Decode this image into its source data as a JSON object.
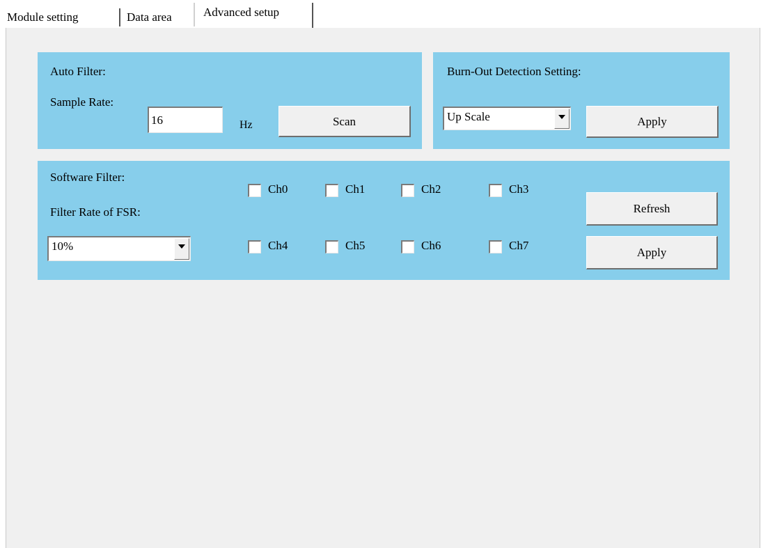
{
  "tabs": [
    {
      "label": "Module setting"
    },
    {
      "label": "Data area"
    },
    {
      "label": "Advanced setup"
    }
  ],
  "auto_filter": {
    "title": "Auto Filter:",
    "sample_rate_label": "Sample Rate:",
    "sample_rate_value": "16",
    "unit": "Hz",
    "scan_label": "Scan"
  },
  "burnout": {
    "title": "Burn-Out Detection Setting:",
    "selected": "Up Scale",
    "apply_label": "Apply"
  },
  "software_filter": {
    "title": "Software Filter:",
    "rate_label": "Filter Rate of FSR:",
    "rate_selected": "10%",
    "channels": [
      "Ch0",
      "Ch1",
      "Ch2",
      "Ch3",
      "Ch4",
      "Ch5",
      "Ch6",
      "Ch7"
    ],
    "refresh_label": "Refresh",
    "apply_label": "Apply"
  }
}
